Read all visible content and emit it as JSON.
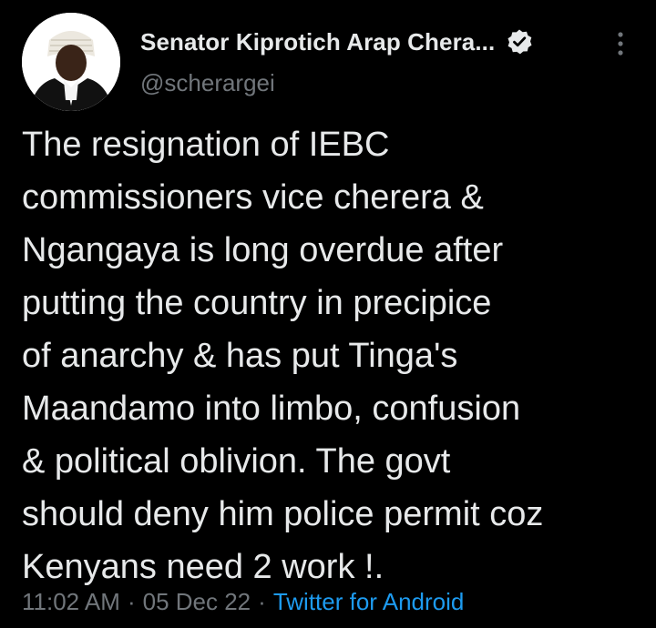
{
  "author": {
    "display_name": "Senator Kiprotich Arap Chera...",
    "handle": "@scherargei",
    "verified_icon": "verified-badge-icon",
    "more_icon": "more-vertical-icon"
  },
  "tweet": {
    "lines": [
      "The resignation of IEBC",
      "commissioners vice cherera &",
      "Ngangaya is long overdue after",
      "putting the country in precipice",
      "of anarchy & has put Tinga's",
      "Maandamo into limbo, confusion",
      "& political oblivion. The govt",
      "should deny him police permit coz",
      "Kenyans need 2 work !."
    ]
  },
  "meta": {
    "time": "11:02 AM",
    "separator": "·",
    "date": "05 Dec 22",
    "source": "Twitter for Android"
  },
  "colors": {
    "background": "#000000",
    "text": "#e7e9ea",
    "secondary": "#71767b",
    "accent": "#1d9bf0"
  }
}
